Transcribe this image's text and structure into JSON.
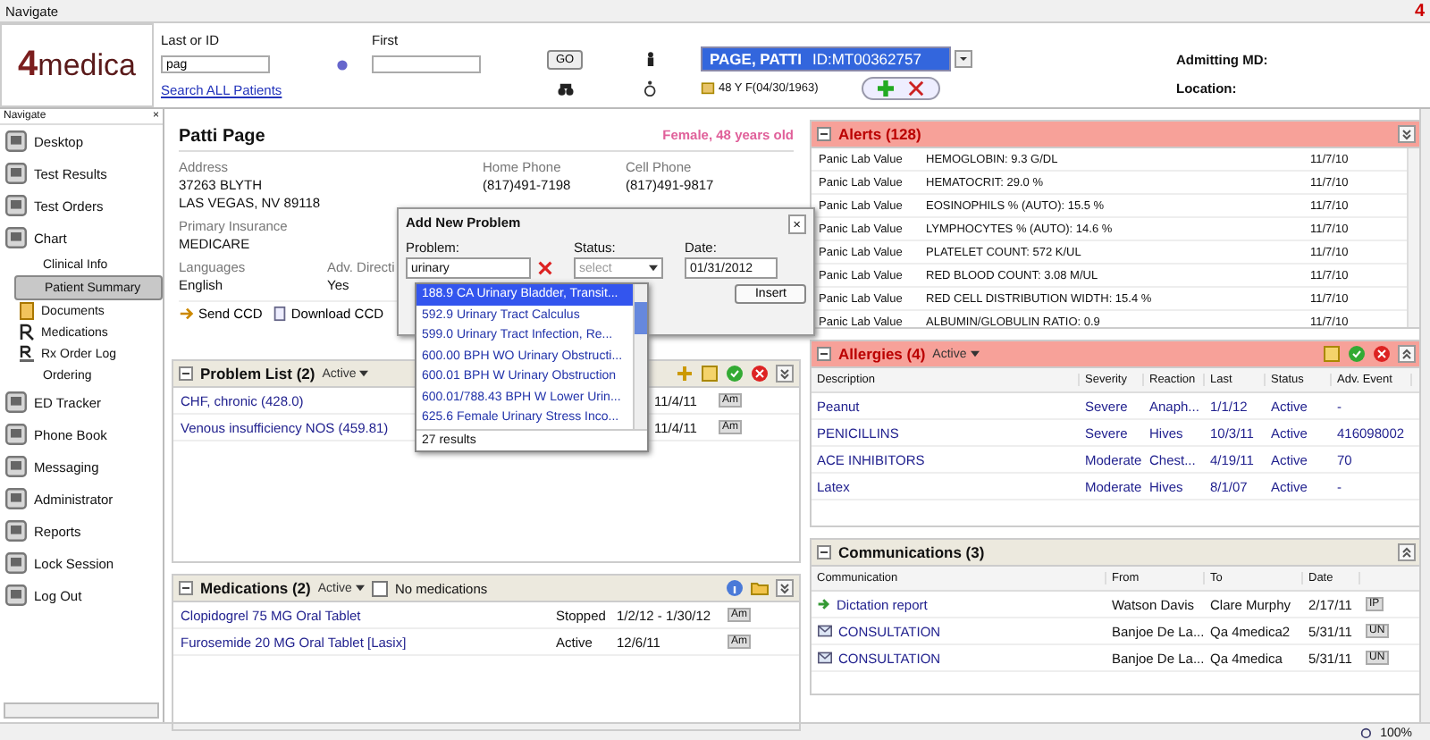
{
  "window": {
    "title": "Navigate",
    "badge": "4"
  },
  "logo": {
    "digit": "4",
    "word": "medica"
  },
  "search": {
    "last_label": "Last or ID",
    "last_value": "pag",
    "first_label": "First",
    "go": "GO",
    "all_link": "Search ALL Patients"
  },
  "patient_select": {
    "name": "PAGE, PATTI",
    "id": "ID:MT00362757",
    "summary": "48 Y F(04/30/1963)"
  },
  "admitting": {
    "label": "Admitting MD:"
  },
  "location": {
    "label": "Location:"
  },
  "sidebar": {
    "title": "Navigate",
    "close": "×",
    "items": [
      {
        "label": "Desktop",
        "selected": false
      },
      {
        "label": "Test Results",
        "selected": false
      },
      {
        "label": "Test Orders",
        "selected": false
      },
      {
        "label": "Chart",
        "selected": false,
        "children": [
          {
            "label": "Clinical Info",
            "kind": "plain",
            "selected": false
          },
          {
            "label": "Patient Summary",
            "kind": "plain",
            "selected": true
          },
          {
            "label": "Documents",
            "kind": "document",
            "selected": false
          },
          {
            "label": "Medications",
            "kind": "rx",
            "selected": false
          },
          {
            "label": "Rx Order Log",
            "kind": "rxlog",
            "selected": false
          },
          {
            "label": "Ordering",
            "kind": "plain",
            "selected": false
          }
        ]
      },
      {
        "label": "ED Tracker",
        "selected": false
      },
      {
        "label": "Phone Book",
        "selected": false
      },
      {
        "label": "Messaging",
        "selected": false
      },
      {
        "label": "Administrator",
        "selected": false
      },
      {
        "label": "Reports",
        "selected": false
      },
      {
        "label": "Lock Session",
        "selected": false
      },
      {
        "label": "Log Out",
        "selected": false
      }
    ]
  },
  "patient": {
    "name": "Patti Page",
    "demographics": "Female, 48 years old",
    "fields": [
      {
        "label": "Address",
        "lines": [
          "37263 BLYTH",
          "LAS VEGAS, NV 89118"
        ]
      },
      {
        "label": "Home Phone",
        "lines": [
          "(817)491-7198"
        ]
      },
      {
        "label": "Cell Phone",
        "lines": [
          "(817)491-9817"
        ]
      }
    ],
    "insurance": {
      "label": "Primary Insurance",
      "value": "MEDICARE"
    },
    "languages": {
      "label": "Languages",
      "value": "English"
    },
    "directive": {
      "label": "Adv. Directi",
      "value": "Yes"
    },
    "buttons": [
      "Send CCD",
      "Download CCD"
    ]
  },
  "add_problem": {
    "title": "Add New Problem",
    "close": "×",
    "problem_label": "Problem:",
    "problem_value": "urinary",
    "status_label": "Status:",
    "status_placeholder": "select",
    "date_label": "Date:",
    "date_value": "01/31/2012",
    "insert": "Insert",
    "results": [
      {
        "label": "188.9 CA Urinary Bladder, Transit...",
        "selected": true
      },
      {
        "label": "592.9 Urinary Tract Calculus",
        "selected": false
      },
      {
        "label": "599.0 Urinary Tract Infection, Re...",
        "selected": false
      },
      {
        "label": "600.00 BPH WO Urinary Obstructi...",
        "selected": false
      },
      {
        "label": "600.01 BPH W Urinary Obstruction",
        "selected": false
      },
      {
        "label": "600.01/788.43 BPH W Lower Urin...",
        "selected": false
      },
      {
        "label": "625.6 Female Urinary Stress Inco...",
        "selected": false
      }
    ],
    "result_count": "27 results"
  },
  "problem_list": {
    "title": "Problem List (2)",
    "filter": "Active",
    "rows": [
      {
        "name": "CHF, chronic (428.0)",
        "date": "11/4/11",
        "tag": "Am"
      },
      {
        "name": "Venous insufficiency NOS (459.81)",
        "date": "11/4/11",
        "tag": "Am"
      }
    ]
  },
  "medications": {
    "title": "Medications (2)",
    "filter": "Active",
    "no_meds": {
      "label": "No medications",
      "checked": false
    },
    "rows": [
      {
        "name": "Clopidogrel 75 MG Oral Tablet",
        "status": "Stopped",
        "dates": "1/2/12 - 1/30/12",
        "tag": "Am"
      },
      {
        "name": "Furosemide 20 MG Oral Tablet [Lasix]",
        "status": "Active",
        "dates": "12/6/11",
        "tag": "Am"
      }
    ]
  },
  "alerts": {
    "title": "Alerts (128)",
    "rows": [
      {
        "type": "Panic Lab Value",
        "text": "HEMOGLOBIN: 9.3 G/DL",
        "date": "11/7/10"
      },
      {
        "type": "Panic Lab Value",
        "text": "HEMATOCRIT: 29.0 %",
        "date": "11/7/10"
      },
      {
        "type": "Panic Lab Value",
        "text": "EOSINOPHILS % (AUTO): 15.5 %",
        "date": "11/7/10"
      },
      {
        "type": "Panic Lab Value",
        "text": "LYMPHOCYTES % (AUTO): 14.6 %",
        "date": "11/7/10"
      },
      {
        "type": "Panic Lab Value",
        "text": "PLATELET COUNT: 572 K/UL",
        "date": "11/7/10"
      },
      {
        "type": "Panic Lab Value",
        "text": "RED BLOOD COUNT: 3.08 M/UL",
        "date": "11/7/10"
      },
      {
        "type": "Panic Lab Value",
        "text": "RED CELL DISTRIBUTION WIDTH: 15.4 %",
        "date": "11/7/10"
      },
      {
        "type": "Panic Lab Value",
        "text": "ALBUMIN/GLOBULIN RATIO: 0.9",
        "date": "11/7/10"
      }
    ]
  },
  "allergies": {
    "title": "Allergies (4)",
    "filter": "Active",
    "columns": [
      "Description",
      "Severity",
      "Reaction",
      "Last",
      "Status",
      "Adv. Event"
    ],
    "rows": [
      [
        "Peanut",
        "Severe",
        "Anaph...",
        "1/1/12",
        "Active",
        "-"
      ],
      [
        "PENICILLINS",
        "Severe",
        "Hives",
        "10/3/11",
        "Active",
        "416098002"
      ],
      [
        "ACE INHIBITORS",
        "Moderate",
        "Chest...",
        "4/19/11",
        "Active",
        "70"
      ],
      [
        "Latex",
        "Moderate",
        "Hives",
        "8/1/07",
        "Active",
        "-"
      ]
    ]
  },
  "communications": {
    "title": "Communications (3)",
    "columns": [
      "Communication",
      "From",
      "To",
      "Date"
    ],
    "rows": [
      {
        "kind": "dictation",
        "subject": "Dictation report",
        "from": "Watson Davis",
        "to": "Clare Murphy",
        "date": "2/17/11",
        "tag": "IP"
      },
      {
        "kind": "mail",
        "subject": "CONSULTATION",
        "from": "Banjoe De La...",
        "to": "Qa 4medica2",
        "date": "5/31/11",
        "tag": "UN"
      },
      {
        "kind": "mail",
        "subject": "CONSULTATION",
        "from": "Banjoe De La...",
        "to": "Qa 4medica",
        "date": "5/31/11",
        "tag": "UN"
      }
    ]
  },
  "status_bar": {
    "zoom": "100%"
  }
}
